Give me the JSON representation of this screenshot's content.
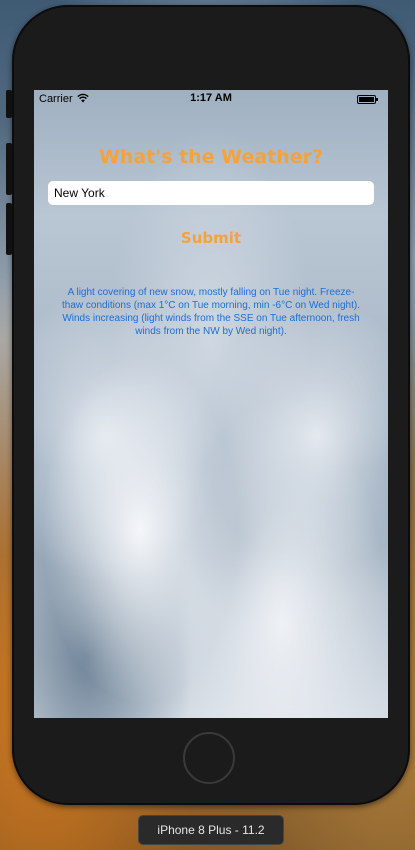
{
  "status_bar": {
    "carrier": "Carrier",
    "time": "1:17 AM",
    "icons": [
      "wifi-icon",
      "battery-icon"
    ]
  },
  "app": {
    "title": "What's the Weather?",
    "city_input_value": "New York",
    "submit_label": "Submit",
    "forecast_text": "A light covering of new snow, mostly falling on Tue night. Freeze-thaw conditions (max 1°C on Tue morning, min -6°C on Wed night). Winds increasing (light winds from the SSE on Tue afternoon, fresh winds from the NW by Wed night)."
  },
  "simulator": {
    "device_label": "iPhone 8 Plus - 11.2"
  },
  "colors": {
    "accent": "#f4a23c",
    "forecast_text": "#1a6fd8"
  }
}
